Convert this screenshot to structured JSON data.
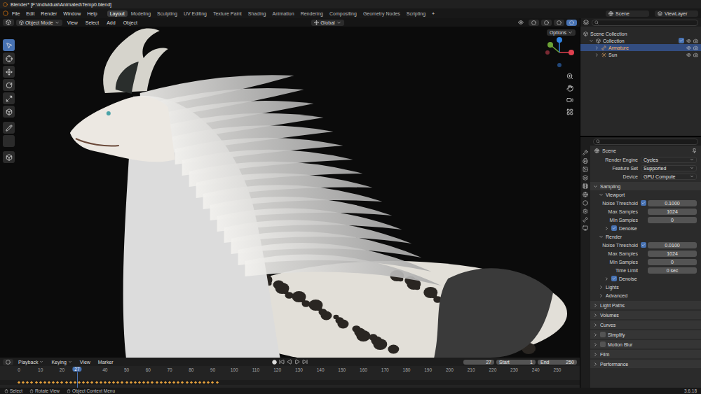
{
  "window": {
    "title": "Blender* [F:\\Individual\\Animated\\Temp0.blend]"
  },
  "menu": [
    "File",
    "Edit",
    "Render",
    "Window",
    "Help"
  ],
  "workspaces": [
    {
      "label": "Layout",
      "selected": true
    },
    {
      "label": "Modeling",
      "selected": false
    },
    {
      "label": "Sculpting",
      "selected": false
    },
    {
      "label": "UV Editing",
      "selected": false
    },
    {
      "label": "Texture Paint",
      "selected": false
    },
    {
      "label": "Shading",
      "selected": false
    },
    {
      "label": "Animation",
      "selected": false
    },
    {
      "label": "Rendering",
      "selected": false
    },
    {
      "label": "Compositing",
      "selected": false
    },
    {
      "label": "Geometry Nodes",
      "selected": false
    },
    {
      "label": "Scripting",
      "selected": false
    }
  ],
  "add_workspace": "+",
  "scene": "Scene",
  "view_layer": "ViewLayer",
  "viewport": {
    "mode": "Object Mode",
    "menus": [
      "View",
      "Select",
      "Add",
      "Object"
    ],
    "orientation": "Global",
    "options": "Options",
    "shading": [
      {
        "selected": false
      },
      {
        "selected": false
      },
      {
        "selected": false
      },
      {
        "selected": true
      }
    ],
    "tools": [
      {
        "selected": true
      },
      {
        "selected": false
      },
      {
        "selected": false
      },
      {
        "selected": false
      },
      {
        "selected": false
      },
      {
        "selected": false
      },
      {
        "selected": false
      },
      {
        "selected": false
      },
      {
        "selected": false
      }
    ]
  },
  "outliner": {
    "items": [
      {
        "label": "Scene Collection",
        "depth": 0,
        "selected": false
      },
      {
        "label": "Collection",
        "depth": 1,
        "expanded": true,
        "checked": true,
        "selected": false
      },
      {
        "label": "Armature",
        "depth": 2,
        "expanded": false,
        "selected": true
      },
      {
        "label": "Sun",
        "depth": 2,
        "expanded": false,
        "selected": false
      }
    ]
  },
  "properties": {
    "context": "Scene",
    "rows": [
      {
        "kind": "select",
        "label": "Render Engine",
        "value": "Cycles"
      },
      {
        "kind": "select",
        "label": "Feature Set",
        "value": "Supported"
      },
      {
        "kind": "select",
        "label": "Device",
        "value": "GPU Compute"
      },
      {
        "kind": "panel",
        "label": "Sampling",
        "depth": 0,
        "expanded": true
      },
      {
        "kind": "panel",
        "label": "Viewport",
        "depth": 1,
        "expanded": true
      },
      {
        "kind": "number",
        "label": "Noise Threshold",
        "value": "0.1000",
        "checkbox": true,
        "checked": true
      },
      {
        "kind": "number",
        "label": "Max Samples",
        "value": "1024",
        "checkbox": false
      },
      {
        "kind": "number",
        "label": "Min Samples",
        "value": "0",
        "checkbox": false
      },
      {
        "kind": "panel",
        "label": "Denoise",
        "depth": 2,
        "expanded": false,
        "checkbox": true,
        "checked": true
      },
      {
        "kind": "panel",
        "label": "Render",
        "depth": 1,
        "expanded": true
      },
      {
        "kind": "number",
        "label": "Noise Threshold",
        "value": "0.0100",
        "checkbox": true,
        "checked": true
      },
      {
        "kind": "number",
        "label": "Max Samples",
        "value": "1024",
        "checkbox": false
      },
      {
        "kind": "number",
        "label": "Min Samples",
        "value": "0",
        "checkbox": false
      },
      {
        "kind": "number",
        "label": "Time Limit",
        "value": "0 sec",
        "checkbox": false
      },
      {
        "kind": "panel",
        "label": "Denoise",
        "depth": 2,
        "expanded": false,
        "checkbox": true,
        "checked": true
      },
      {
        "kind": "panel",
        "label": "Lights",
        "depth": 1,
        "expanded": false
      },
      {
        "kind": "panel",
        "label": "Advanced",
        "depth": 1,
        "expanded": false
      },
      {
        "kind": "panel",
        "label": "Light Paths",
        "depth": 0,
        "expanded": false
      },
      {
        "kind": "panel",
        "label": "Volumes",
        "depth": 0,
        "expanded": false
      },
      {
        "kind": "panel",
        "label": "Curves",
        "depth": 0,
        "expanded": false
      },
      {
        "kind": "panel",
        "label": "Simplify",
        "depth": 0,
        "expanded": false,
        "checkbox": true,
        "checked": false
      },
      {
        "kind": "panel",
        "label": "Motion Blur",
        "depth": 0,
        "expanded": false,
        "checkbox": true,
        "checked": false
      },
      {
        "kind": "panel",
        "label": "Film",
        "depth": 0,
        "expanded": false
      },
      {
        "kind": "panel",
        "label": "Performance",
        "depth": 0,
        "expanded": false
      }
    ]
  },
  "timeline": {
    "menus": [
      {
        "label": "Playback",
        "dropdown": true
      },
      {
        "label": "Keying",
        "dropdown": true
      },
      {
        "label": "View",
        "dropdown": false
      },
      {
        "label": "Marker",
        "dropdown": false
      }
    ],
    "current_frame": "27",
    "start_label": "Start",
    "start": "1",
    "end_label": "End",
    "end": "250",
    "ticks": [
      "0",
      "10",
      "20",
      "40",
      "50",
      "60",
      "70",
      "80",
      "90",
      "100",
      "110",
      "120",
      "130",
      "140",
      "150",
      "160",
      "170",
      "180",
      "190",
      "200",
      "210",
      "220",
      "230",
      "240",
      "250"
    ],
    "keyframes": {
      "from": 0,
      "to": 92,
      "step": 2
    }
  },
  "status_bar": {
    "hints": [
      "Select",
      "Rotate View",
      "Object Context Menu"
    ],
    "version": "3.6.18"
  }
}
